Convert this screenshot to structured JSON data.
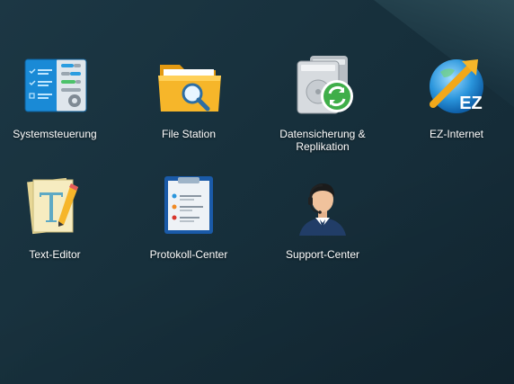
{
  "desktop": {
    "apps": [
      {
        "label": "Systemsteuerung",
        "icon": "control-panel-icon"
      },
      {
        "label": "File Station",
        "icon": "folder-search-icon"
      },
      {
        "label": "Datensicherung &\nReplikation",
        "icon": "backup-replication-icon"
      },
      {
        "label": "EZ-Internet",
        "icon": "globe-arrow-icon"
      },
      {
        "label": "Text-Editor",
        "icon": "text-editor-icon"
      },
      {
        "label": "Protokoll-Center",
        "icon": "log-clipboard-icon"
      },
      {
        "label": "Support-Center",
        "icon": "support-agent-icon"
      }
    ],
    "ez_badge": "EZ"
  }
}
